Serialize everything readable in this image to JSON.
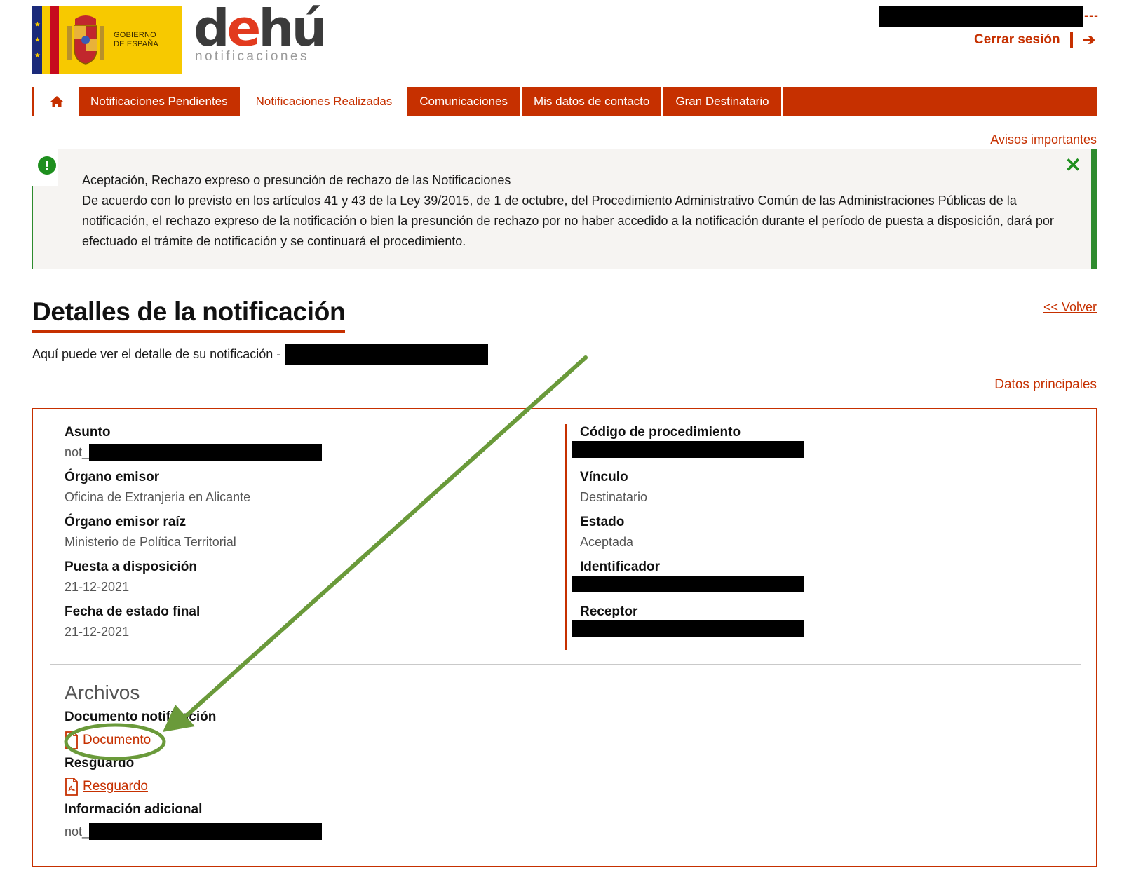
{
  "header": {
    "gob_logo_text": "GOBIERNO\nDE ESPAÑA",
    "dehu_brand": "dehú",
    "dehu_sub": "notificaciones",
    "user_dashes": "---",
    "logout_label": "Cerrar sesión"
  },
  "nav": {
    "home_icon": "home-icon",
    "tabs": [
      {
        "label": "Notificaciones Pendientes",
        "active": false
      },
      {
        "label": "Notificaciones Realizadas",
        "active": true
      },
      {
        "label": "Comunicaciones",
        "active": false
      },
      {
        "label": "Mis datos de contacto",
        "active": false
      },
      {
        "label": "Gran Destinatario",
        "active": false
      }
    ]
  },
  "avisos_label": "Avisos importantes",
  "alert": {
    "title": "Aceptación, Rechazo expreso o presunción de rechazo de las Notificaciones",
    "body": "De acuerdo con lo previsto en los artículos 41 y 43 de la Ley 39/2015, de 1 de octubre, del Procedimiento Administrativo Común de las Administraciones Públicas de la notificación, el rechazo expreso de la notificación o bien la presunción de rechazo por no haber accedido a la notificación durante el período de puesta a disposición, dará por efectuado el trámite de notificación y se continuará el procedimiento.",
    "close_symbol": "✕",
    "icon_symbol": "!"
  },
  "page": {
    "title": "Detalles de la notificación",
    "back_label": "<< Volver",
    "subtitle": "Aquí puede ver el detalle de su notificación -",
    "section_label": "Datos principales"
  },
  "details": {
    "left": [
      {
        "label": "Asunto",
        "value": "not_",
        "redacted": true
      },
      {
        "label": "Órgano emisor",
        "value": "Oficina de Extranjeria en Alicante"
      },
      {
        "label": "Órgano emisor raíz",
        "value": "Ministerio de Política Territorial"
      },
      {
        "label": "Puesta a disposición",
        "value": "21-12-2021"
      },
      {
        "label": "Fecha de estado final",
        "value": "21-12-2021"
      }
    ],
    "right": [
      {
        "label": "Código de procedimiento",
        "value": "",
        "redacted": true
      },
      {
        "label": "Vínculo",
        "value": "Destinatario"
      },
      {
        "label": "Estado",
        "value": "Aceptada"
      },
      {
        "label": "Identificador",
        "value": "",
        "redacted": true
      },
      {
        "label": "Receptor",
        "value": "",
        "redacted": true
      }
    ]
  },
  "archivos": {
    "heading": "Archivos",
    "documento_label": "Documento notificación",
    "documento_link": "Documento",
    "resguardo_label": "Resguardo",
    "resguardo_link": "Resguardo",
    "info_label": "Información adicional",
    "info_value": "not_"
  },
  "colors": {
    "accent": "#c63000",
    "alert_green": "#2e8b2e",
    "annotation_green": "#6a9a3a"
  }
}
